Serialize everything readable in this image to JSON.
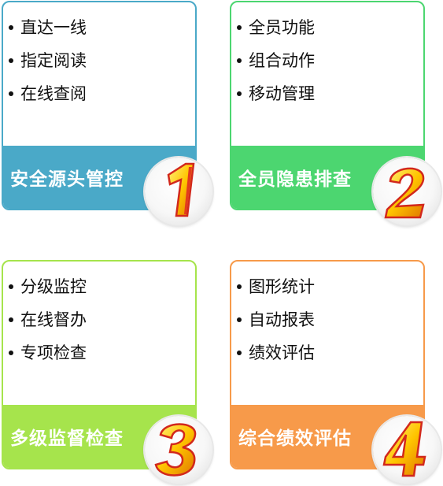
{
  "cards": [
    {
      "title": "安全源头管控",
      "items": [
        "直达一线",
        "指定阅读",
        "在线查阅"
      ],
      "badge": "1",
      "color": "#4aa9c8"
    },
    {
      "title": "全员隐患排查",
      "items": [
        "全员功能",
        "组合动作",
        "移动管理"
      ],
      "badge": "2",
      "color": "#4cd670"
    },
    {
      "title": "多级监督检查",
      "items": [
        "分级监控",
        "在线督办",
        "专项检查"
      ],
      "badge": "3",
      "color": "#a6e44c"
    },
    {
      "title": "综合绩效评估",
      "items": [
        "图形统计",
        "自动报表",
        "绩效评估"
      ],
      "badge": "4",
      "color": "#f79a4a"
    }
  ]
}
